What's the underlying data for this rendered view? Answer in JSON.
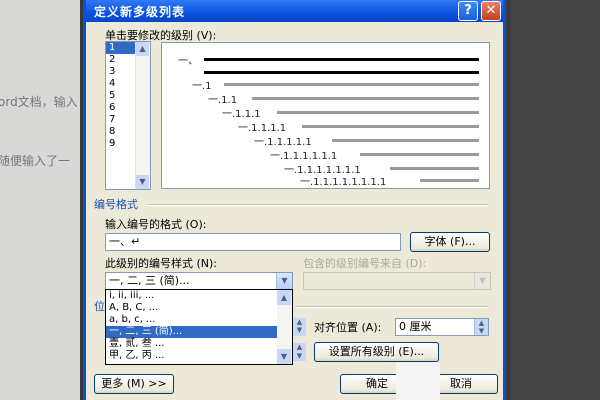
{
  "background": {
    "lines": [
      "ord文档，输入",
      "随便输入了一"
    ]
  },
  "dialog": {
    "title": "定义新多级列表",
    "help_glyph": "?",
    "close_glyph": "✕"
  },
  "level_section": {
    "label": "单击要修改的级别 (V):",
    "levels": [
      "1",
      "2",
      "3",
      "4",
      "5",
      "6",
      "7",
      "8",
      "9"
    ],
    "selected_level": "1"
  },
  "preview": {
    "labels": [
      "一、",
      "一.1",
      "一.1.1",
      "一.1.1.1",
      "一.1.1.1.1",
      "一.1.1.1.1.1",
      "一.1.1.1.1.1.1",
      "一.1.1.1.1.1.1.1",
      "一.1.1.1.1.1.1.1.1"
    ]
  },
  "numbering_format": {
    "group_label": "编号格式",
    "format_label": "输入编号的格式 (O):",
    "format_value": "一、↵",
    "font_button": "字体 (F)...",
    "style_label": "此级别的编号样式 (N):",
    "style_value": "一, 二, 三 (简)...",
    "include_label": "包含的级别编号来自 (D):",
    "include_value": ""
  },
  "style_options": [
    "i, ii, iii, ...",
    "A, B, C, ...",
    "a, b, c, ...",
    "一, 二, 三 (简)...",
    "壹, 贰, 叁 ...",
    "甲, 乙, 丙 ..."
  ],
  "selected_style_index": 3,
  "position": {
    "group_label": "位",
    "align_label": "对齐位置 (A):",
    "align_value": "0 厘米",
    "set_all_button": "设置所有级别 (E)..."
  },
  "footer": {
    "more_button": "更多 (M) >>",
    "ok_button": "确定",
    "cancel_button": "取消"
  },
  "colors": {
    "title_bar": "#0a52e0",
    "selection": "#316ac5",
    "dialog_bg": "#ece9d8"
  }
}
